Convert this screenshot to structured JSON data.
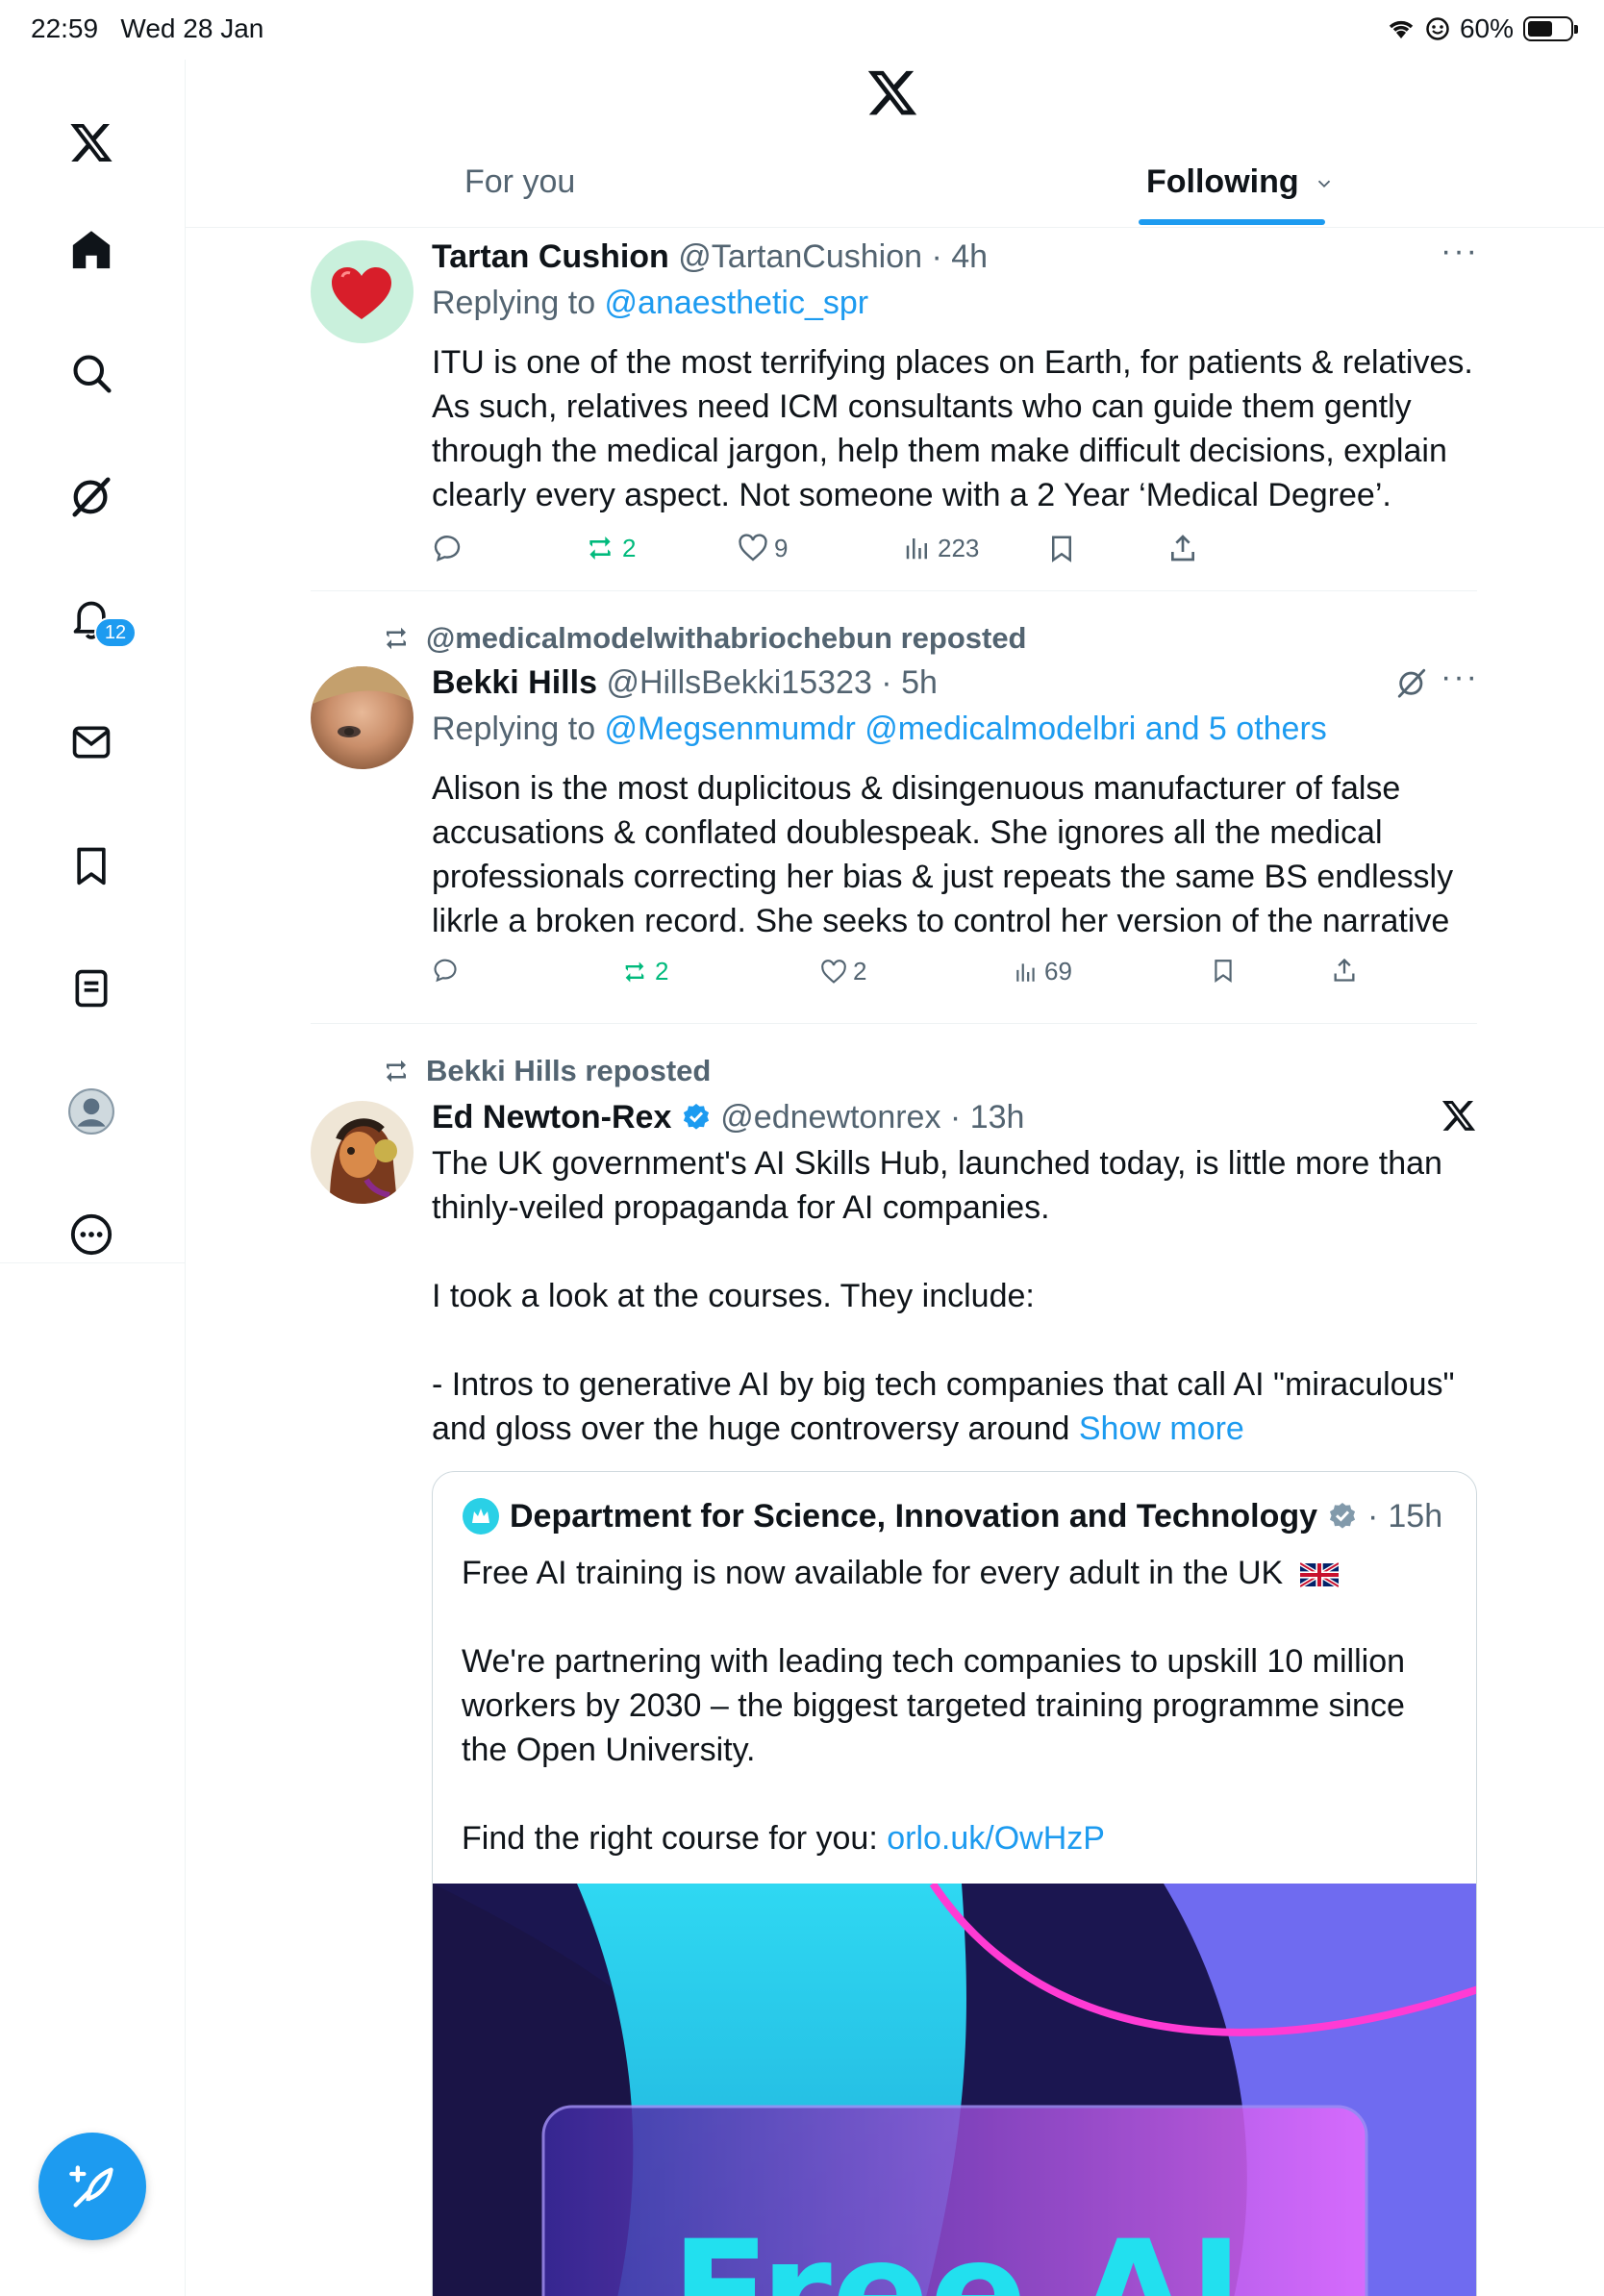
{
  "status_bar": {
    "time": "22:59",
    "date": "Wed 28 Jan",
    "battery": "60%"
  },
  "sidebar": {
    "items": [
      {
        "icon": "x-logo-icon"
      },
      {
        "icon": "home-icon"
      },
      {
        "icon": "search-icon"
      },
      {
        "icon": "grok-icon"
      },
      {
        "icon": "notifications-icon",
        "badge": "12"
      },
      {
        "icon": "messages-icon"
      },
      {
        "icon": "bookmarks-icon"
      },
      {
        "icon": "lists-icon"
      },
      {
        "icon": "profile-icon"
      },
      {
        "icon": "more-icon"
      }
    ]
  },
  "tabs": {
    "for_you": "For you",
    "following": "Following"
  },
  "posts": [
    {
      "name": "Tartan Cushion",
      "handle": "@TartanCushion",
      "time": "4h",
      "replying_label": "Replying to ",
      "replying_to": "@anaesthetic_spr",
      "text": "ITU is one of the most terrifying places on Earth, for patients & relatives. As such, relatives need ICM consultants who can guide them gently through the medical jargon, help them make difficult decisions, explain clearly every aspect. Not someone with a 2 Year ‘Medical Degree’.",
      "reposts": "2",
      "likes": "9",
      "views": "223"
    },
    {
      "repost_by": "@medicalmodelwithabriochebun reposted",
      "name": "Bekki Hills",
      "handle": "@HillsBekki15323",
      "time": "5h",
      "replying_label": "Replying to ",
      "replying_to": "@Megsenmumdr @medicalmodelbri and 5 others",
      "text": "Alison is the most duplicitous & disingenuous manufacturer of false accusations & conflated doublespeak. She ignores all the medical professionals correcting her bias & just repeats the same BS endlessly likrle a broken record. She seeks to control her version of the narrative",
      "reposts": "2",
      "likes": "2",
      "views": "69"
    },
    {
      "repost_by": "Bekki Hills reposted",
      "name": "Ed Newton-Rex",
      "handle": "@ednewtonrex",
      "time": "13h",
      "text_p1": "The UK government's AI Skills Hub, launched today, is little more than thinly-veiled propaganda for AI companies.",
      "text_p2": "I took a look at the courses. They include:",
      "text_p3": "- Intros to generative AI by big tech companies that call AI \"miraculous\" and gloss over the huge controversy around ",
      "show_more": "Show more",
      "quote": {
        "name": "Department for Science, Innovation and Technology",
        "time": "15h",
        "p1": "Free AI training is now available for every adult in the UK",
        "p2": "We're partnering with leading tech companies to upskill 10 million workers by 2030 – the biggest targeted training programme since the Open University.",
        "p3_label": "Find the right course for you: ",
        "link": "orlo.uk/OwHzP",
        "image_text": "Free AI"
      }
    }
  ]
}
